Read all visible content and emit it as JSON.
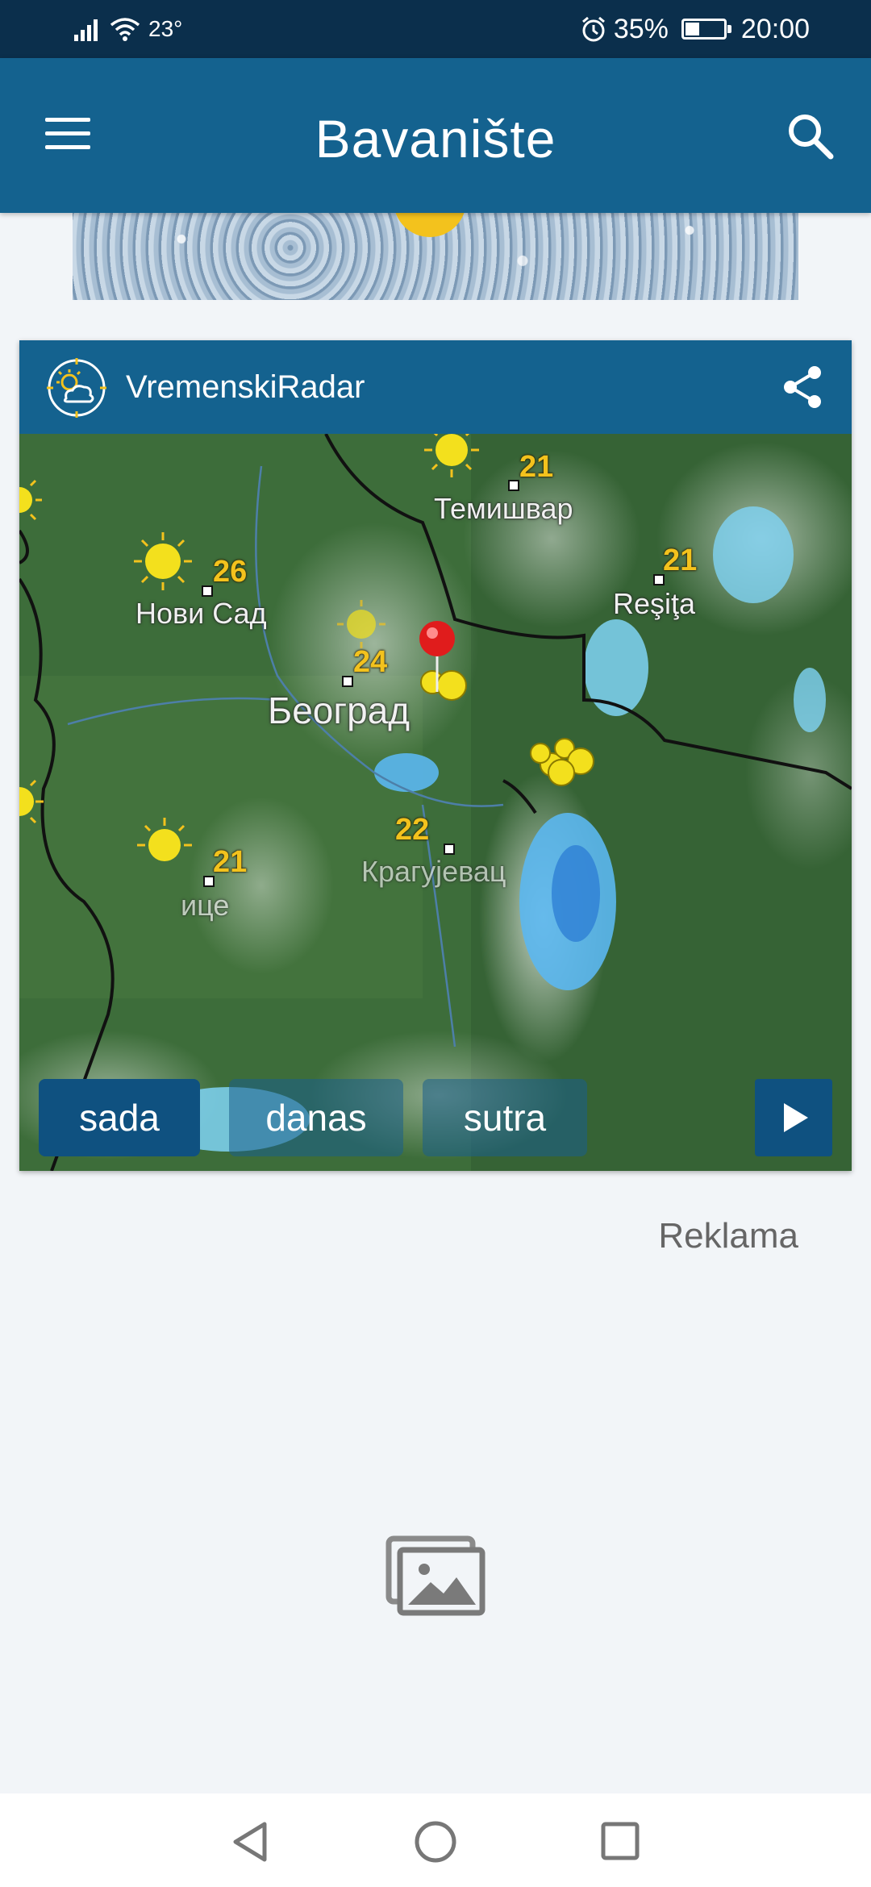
{
  "status_bar": {
    "temperature": "23°",
    "battery": "35%",
    "battery_level": 0.35,
    "time": "20:00"
  },
  "app_bar": {
    "title": "Bavanište"
  },
  "radar_card": {
    "brand": "VremenskiRadar",
    "cities": [
      {
        "name": "Темишвар"
      },
      {
        "name": "Нови Сад"
      },
      {
        "name": "Reşiţa"
      },
      {
        "name": "Београд"
      },
      {
        "name": "Крагујевац"
      },
      {
        "name": "ице"
      }
    ],
    "temperatures": [
      "21",
      "26",
      "21",
      "24",
      "22",
      "21"
    ],
    "buttons": {
      "now": "sada",
      "today": "danas",
      "tomorrow": "sutra"
    }
  },
  "ad": {
    "label": "Reklama"
  },
  "icons": {
    "menu": "menu-icon",
    "search": "search-icon",
    "share": "share-icon",
    "play": "play-icon",
    "image_placeholder": "image-placeholder-icon",
    "alarm": "alarm-icon",
    "wifi": "wifi-icon",
    "signal": "signal-icon"
  },
  "colors": {
    "primary": "#14628f",
    "status_bar": "#0b2f4c",
    "accent_sun": "#f3c21d",
    "background": "#f2f5f8"
  }
}
